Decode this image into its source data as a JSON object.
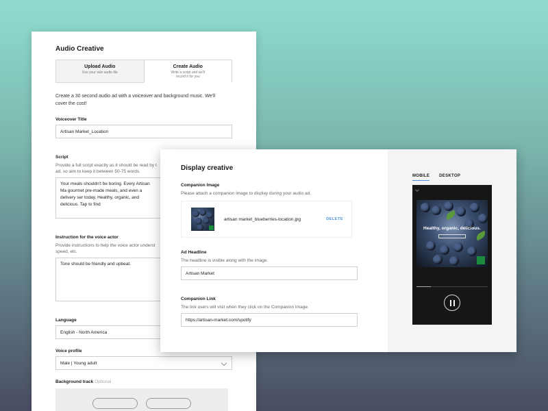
{
  "audio": {
    "title": "Audio Creative",
    "tabs": [
      {
        "label": "Upload Audio",
        "sub": "Use your own audio file"
      },
      {
        "label": "Create Audio",
        "sub": "Write a script and we'll record it for you"
      }
    ],
    "intro": "Create a 30 second audio ad with a voiceover and background music. We'll cover the cost!",
    "voiceover_title": {
      "label": "Voiceover Title",
      "value": "Artisan Market_Location"
    },
    "script": {
      "label": "Script",
      "help": "Provide a full script exactly as it should be read by t ad, so aim to keep it between 50-75 words.",
      "value": "Your meals shouldn't be boring. Every Artisan Ma gourmet pre-made meals, and even a delivery ser today. Healthy, organic, and delicious. Tap to find"
    },
    "instruction": {
      "label": "Instruction for the voice actor",
      "help": "Provide instructions to help the voice actor underst speed, etc.",
      "value": "Tone should be friendly and upbeat."
    },
    "language": {
      "label": "Language",
      "value": "English - North America"
    },
    "voice_profile": {
      "label": "Voice profile",
      "value": "Male | Young adult"
    },
    "background_track": {
      "label": "Background track",
      "optional": "Optional"
    }
  },
  "display": {
    "title": "Display creative",
    "companion_image": {
      "label": "Companion Image",
      "help": "Please attach a companion image to display during your audio ad.",
      "file": "artisan market_blueberries-location.jpg",
      "delete": "DELETE"
    },
    "ad_headline": {
      "label": "Ad Headline",
      "help": "The headline is visible along with the image.",
      "value": "Artisan Market"
    },
    "companion_link": {
      "label": "Companion Link",
      "help": "The link users will visit when they click on the Companion Image.",
      "value": "https://artisan-market.com/spotify"
    }
  },
  "preview": {
    "tabs": [
      "MOBILE",
      "DESKTOP"
    ],
    "active_tab": "MOBILE",
    "art_headline": "Healthy, organic, delicious.",
    "progress": 0.2
  },
  "icons": {
    "select_chevron": "chevron-down-icon",
    "pause": "pause-icon"
  },
  "colors": {
    "accent": "#4a90e2",
    "badge_green": "#1c8a3d"
  }
}
